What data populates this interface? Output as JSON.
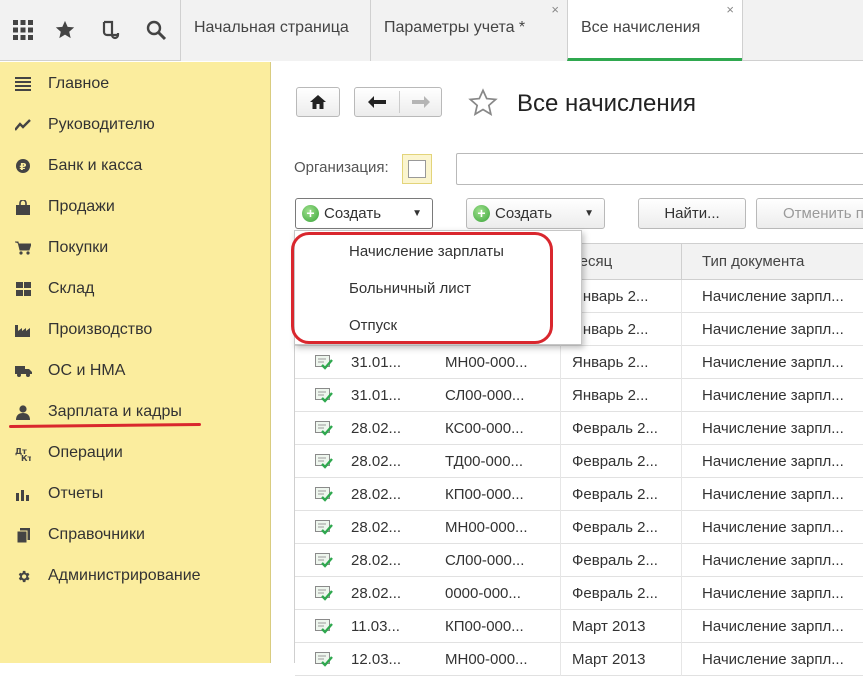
{
  "toolbar": {
    "icons": [
      "apps-grid-icon",
      "star-icon",
      "history-icon",
      "search-icon"
    ]
  },
  "tabs": [
    {
      "label": "Начальная страница",
      "closable": false,
      "active": false
    },
    {
      "label": "Параметры учета *",
      "closable": true,
      "active": false
    },
    {
      "label": "Все начисления",
      "closable": true,
      "active": true
    }
  ],
  "tab_close_glyph": "×",
  "sidebar": {
    "items": [
      {
        "label": "Главное",
        "icon": "menu-lines-icon"
      },
      {
        "label": "Руководителю",
        "icon": "trend-icon"
      },
      {
        "label": "Банк и касса",
        "icon": "ruble-coin-icon"
      },
      {
        "label": "Продажи",
        "icon": "bag-icon"
      },
      {
        "label": "Покупки",
        "icon": "cart-icon"
      },
      {
        "label": "Склад",
        "icon": "warehouse-grid-icon"
      },
      {
        "label": "Производство",
        "icon": "factory-icon"
      },
      {
        "label": "ОС и НМА",
        "icon": "truck-icon"
      },
      {
        "label": "Зарплата и кадры",
        "icon": "person-icon"
      },
      {
        "label": "Операции",
        "icon": "debit-credit-icon"
      },
      {
        "label": "Отчеты",
        "icon": "bar-chart-icon"
      },
      {
        "label": "Справочники",
        "icon": "books-icon"
      },
      {
        "label": "Администрирование",
        "icon": "gear-icon"
      }
    ],
    "highlight_color": "#d9272e"
  },
  "page": {
    "title": "Все начисления",
    "org_label": "Организация:",
    "create_label": "Создать",
    "create2_label": "Создать",
    "find_label": "Найти...",
    "cancel_search_label": "Отменить п"
  },
  "table": {
    "headers": [
      "",
      "",
      "Месяц",
      "Тип документа"
    ],
    "rows": [
      {
        "date": "",
        "number": "",
        "month": "Январь 2...",
        "type": "Начисление зарпл..."
      },
      {
        "date": "",
        "number": "",
        "month": "Январь 2...",
        "type": "Начисление зарпл..."
      },
      {
        "date": "31.01...",
        "number": "МН00-000...",
        "month": "Январь 2...",
        "type": "Начисление зарпл..."
      },
      {
        "date": "31.01...",
        "number": "СЛ00-000...",
        "month": "Январь 2...",
        "type": "Начисление зарпл..."
      },
      {
        "date": "28.02...",
        "number": "КС00-000...",
        "month": "Февраль 2...",
        "type": "Начисление зарпл..."
      },
      {
        "date": "28.02...",
        "number": "ТД00-000...",
        "month": "Февраль 2...",
        "type": "Начисление зарпл..."
      },
      {
        "date": "28.02...",
        "number": "КП00-000...",
        "month": "Февраль 2...",
        "type": "Начисление зарпл..."
      },
      {
        "date": "28.02...",
        "number": "МН00-000...",
        "month": "Февраль 2...",
        "type": "Начисление зарпл..."
      },
      {
        "date": "28.02...",
        "number": "СЛ00-000...",
        "month": "Февраль 2...",
        "type": "Начисление зарпл..."
      },
      {
        "date": "28.02...",
        "number": "0000-000...",
        "month": "Февраль 2...",
        "type": "Начисление зарпл..."
      },
      {
        "date": "11.03...",
        "number": "КП00-000...",
        "month": "Март 2013",
        "type": "Начисление зарпл..."
      },
      {
        "date": "12.03...",
        "number": "МН00-000...",
        "month": "Март 2013",
        "type": "Начисление зарпл..."
      }
    ]
  },
  "dropdown": {
    "items": [
      "Начисление зарплаты",
      "Больничный лист",
      "Отпуск"
    ],
    "annotation_color": "#d9272e"
  }
}
